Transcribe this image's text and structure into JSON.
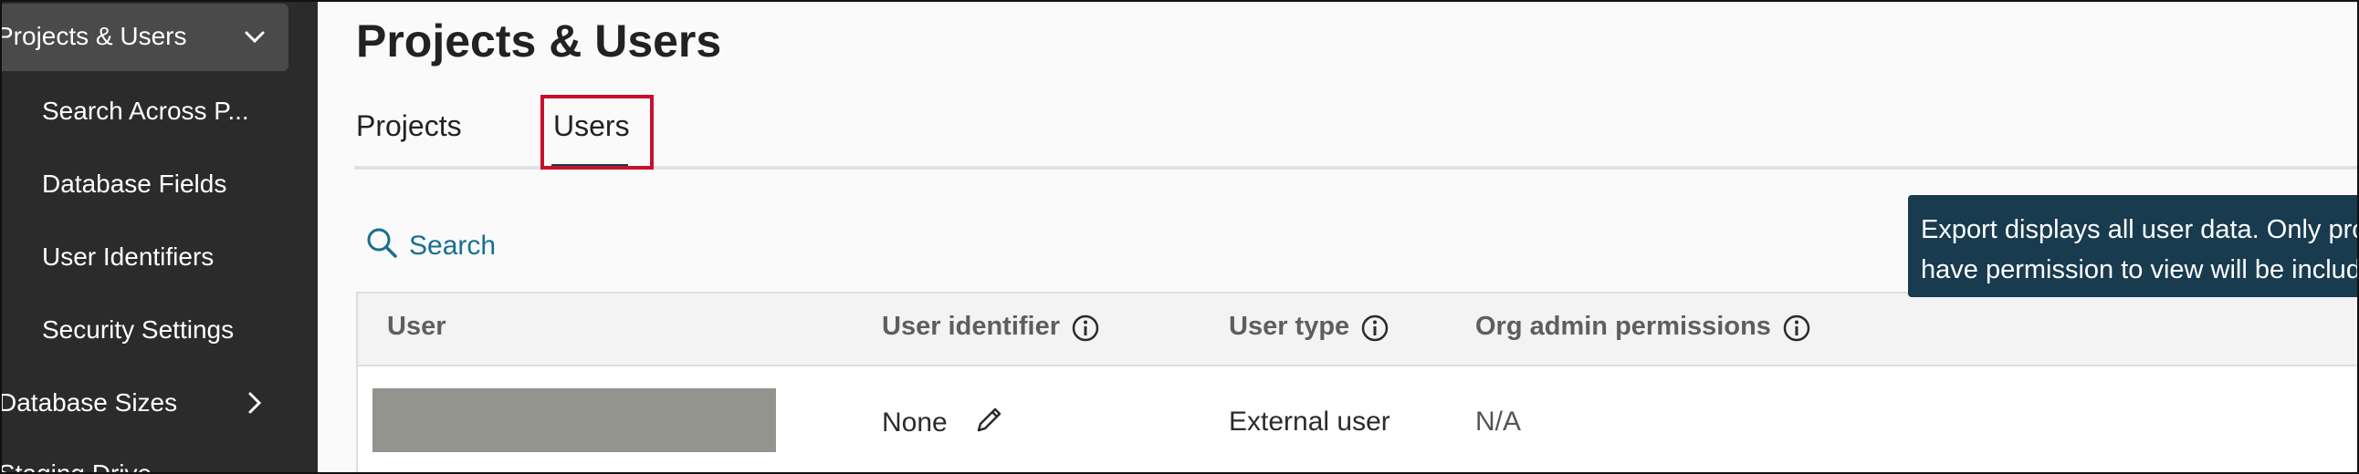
{
  "sidebar": {
    "parent_label": "Projects & Users",
    "items": [
      {
        "label": "Search Across P..."
      },
      {
        "label": "Database Fields"
      },
      {
        "label": "User Identifiers"
      },
      {
        "label": "Security Settings"
      }
    ],
    "database_sizes_label": "Database Sizes",
    "staging_drive_label": "Staging Drive"
  },
  "main": {
    "title": "Projects & Users",
    "tabs": [
      {
        "label": "Projects",
        "active": false
      },
      {
        "label": "Users",
        "active": true
      }
    ],
    "search_label": "Search",
    "tooltip": "Export displays all user data. Only projects that you have permission to view will be included.",
    "table": {
      "headers": [
        "User",
        "User identifier",
        "User type",
        "Org admin permissions"
      ],
      "rows": [
        {
          "user": "",
          "identifier": "None",
          "type": "External user",
          "org_admin": "N/A"
        }
      ]
    }
  },
  "colors": {
    "sidebar_bg": "#2b2b2b",
    "accent": "#1f6f93",
    "tooltip_bg": "#183b4f",
    "highlight": "#c8102e"
  }
}
